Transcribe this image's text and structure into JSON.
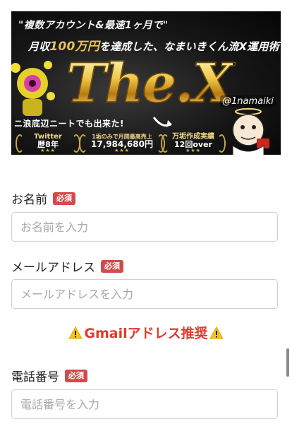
{
  "banner": {
    "tagline": "\"複数アカウント&最速1ヶ月で\"",
    "subtitle_pre": "月収",
    "subtitle_amount": "100万円",
    "subtitle_post": "を達成した、なまいきくん流X運用術",
    "title": "The.X",
    "handle": "@1namaiki",
    "ribbon": "ニ浪底辺ニートでも出来た!",
    "stats": [
      {
        "label": "Twitter",
        "value": "歴8年"
      },
      {
        "label": "1垢のみで月間最高売上",
        "value": "17,984,680円"
      },
      {
        "label": "万垢作成実績",
        "value": "12回over"
      }
    ]
  },
  "form": {
    "required_badge": "必須",
    "name": {
      "label": "お名前",
      "placeholder": "お名前を入力"
    },
    "email": {
      "label": "メールアドレス",
      "placeholder": "メールアドレスを入力"
    },
    "email_note": "Gmailアドレス推奨",
    "phone": {
      "label": "電話番号",
      "placeholder": "電話番号を入力"
    }
  },
  "colors": {
    "required": "#d14b4b",
    "note": "#e23a2e",
    "gold": "#e8c25a"
  },
  "icons": {
    "warning": "warning-icon"
  }
}
